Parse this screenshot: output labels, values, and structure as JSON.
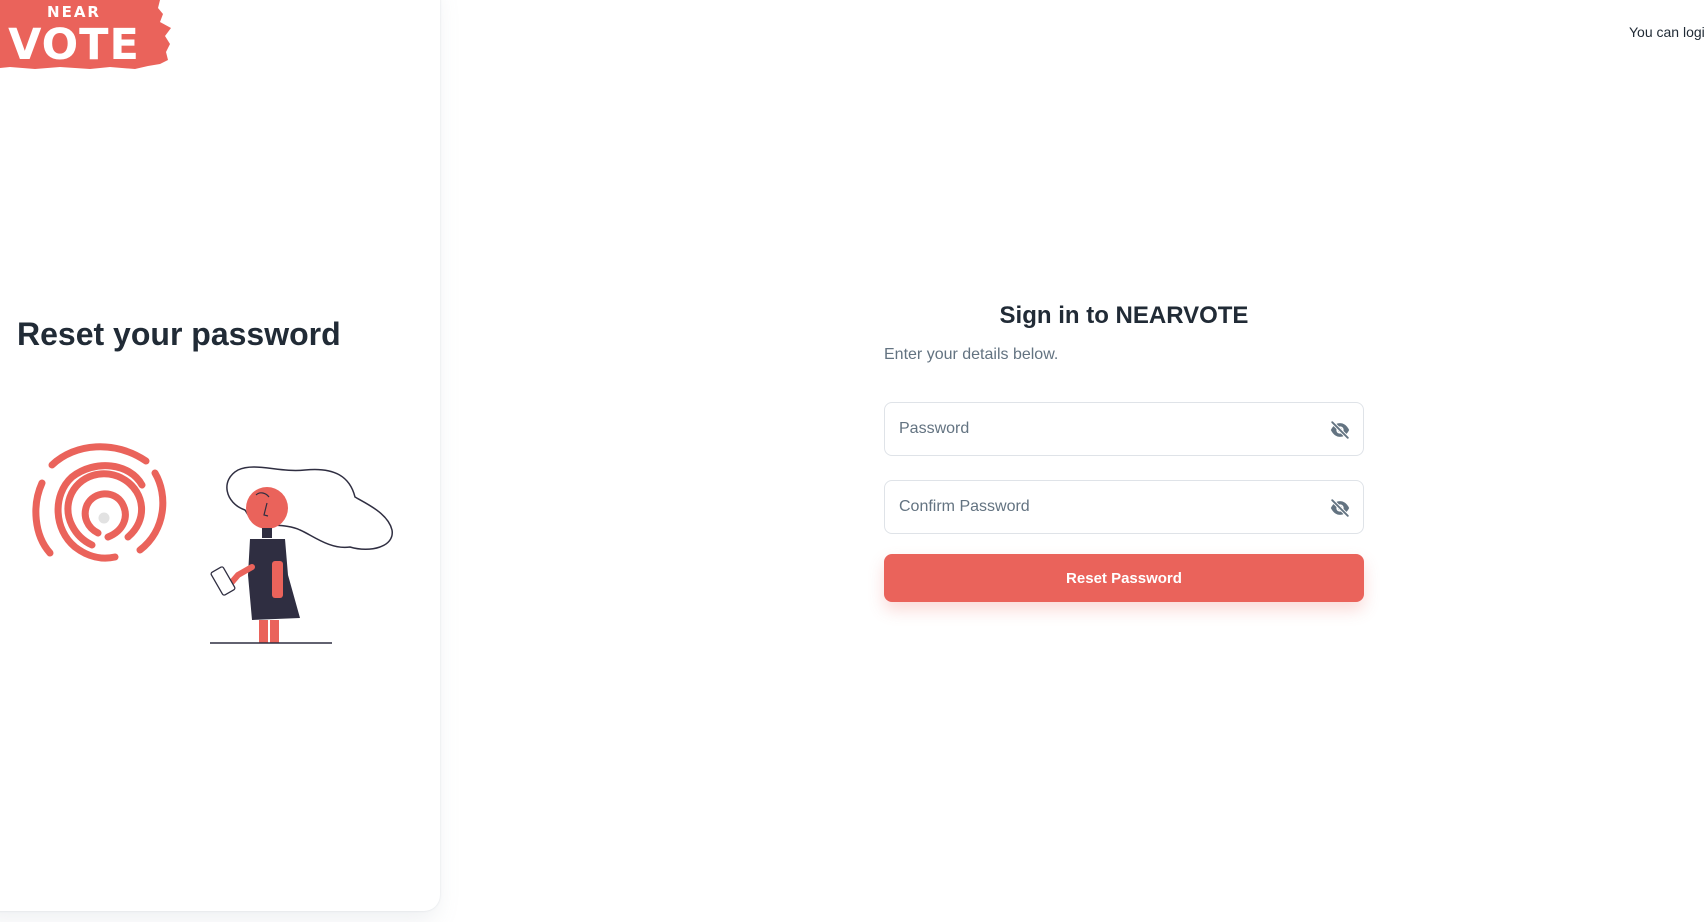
{
  "brand": {
    "logo_top": "NEAR",
    "logo_bottom": "VOTE",
    "accent_color": "#ea635b"
  },
  "header": {
    "note": "You can logi"
  },
  "side": {
    "title": "Reset your password"
  },
  "form": {
    "title": "Sign in to NEARVOTE",
    "subtitle": "Enter your details below.",
    "password": {
      "placeholder": "Password",
      "value": "",
      "icon": "eye-off-icon"
    },
    "confirm_password": {
      "placeholder": "Confirm Password",
      "value": "",
      "icon": "eye-off-icon"
    },
    "submit_label": "Reset Password"
  }
}
